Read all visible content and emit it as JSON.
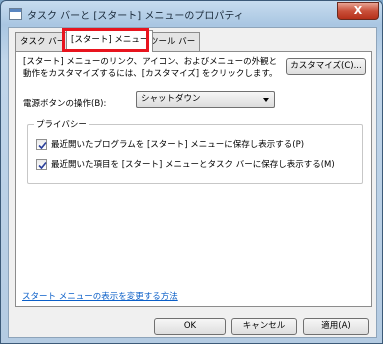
{
  "window": {
    "title": "タスク バーと [スタート] メニューのプロパティ",
    "close_glyph": "X"
  },
  "tabs": [
    {
      "label": "タスク バー",
      "selected": false
    },
    {
      "label": "[スタート] メニュー",
      "selected": true
    },
    {
      "label": "ツール バー",
      "selected": false
    }
  ],
  "start_menu": {
    "description": "[スタート] メニューのリンク、アイコン、およびメニューの外観と動作をカスタマイズするには、[カスタマイズ] をクリックします。",
    "customize_label": "カスタマイズ(C)...",
    "power_button_label": "電源ボタンの操作(B):",
    "power_button_value": "シャットダウン",
    "privacy": {
      "title": "プライバシー",
      "items": [
        {
          "label": "最近開いたプログラムを [スタート] メニューに保存し表示する(P)",
          "checked": true
        },
        {
          "label": "最近開いた項目を [スタート] メニューとタスク バーに保存し表示する(M)",
          "checked": true
        }
      ]
    },
    "link_text": "スタート メニューの表示を変更する方法"
  },
  "footer": {
    "ok_label": "OK",
    "cancel_label": "キャンセル",
    "apply_label": "適用(A)"
  },
  "colors": {
    "highlight": "#e8141e",
    "link": "#0b5fc8"
  }
}
